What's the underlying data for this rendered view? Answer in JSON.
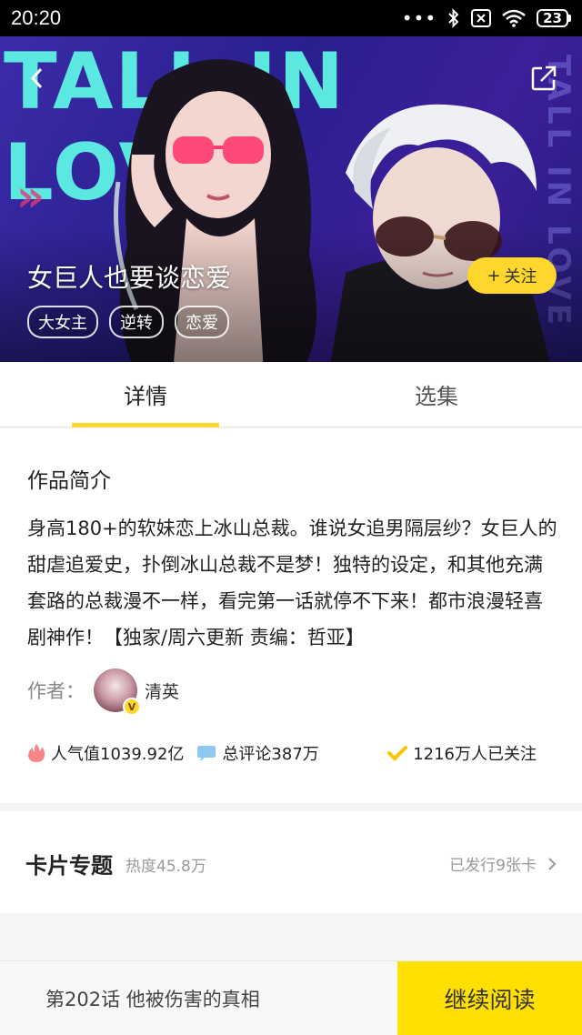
{
  "status_bar": {
    "time": "20:20",
    "battery": "23"
  },
  "hero": {
    "art_text": "TALL IN LOVE",
    "vertical_text": "TALL IN LOVE",
    "title": "女巨人也要谈恋爱",
    "tags": [
      "大女主",
      "逆转",
      "恋爱"
    ],
    "follow_label": "关注",
    "follow_plus": "+",
    "accent_color": "#ffd62c"
  },
  "tabs": [
    {
      "label": "详情",
      "active": true
    },
    {
      "label": "选集",
      "active": false
    }
  ],
  "intro": {
    "heading": "作品简介",
    "text": "身高180+的软妹恋上冰山总裁。谁说女追男隔层纱？女巨人的甜虐追爱史，扑倒冰山总裁不是梦！独特的设定，和其他充满套路的总裁漫不一样，看完第一话就停不下来！都市浪漫轻喜剧神作！【独家/周六更新 责编：哲亚】",
    "author_label": "作者：",
    "author_name": "清英",
    "author_badge": "V"
  },
  "stats": {
    "popularity": "人气值1039.92亿",
    "comments": "总评论387万",
    "followers": "1216万人已关注"
  },
  "card_topic": {
    "title": "卡片专题",
    "heat": "热度45.8万",
    "issued": "已发行9张卡"
  },
  "bottom_bar": {
    "last_episode": "第202话 他被伤害的真相",
    "continue_label": "继续阅读"
  }
}
